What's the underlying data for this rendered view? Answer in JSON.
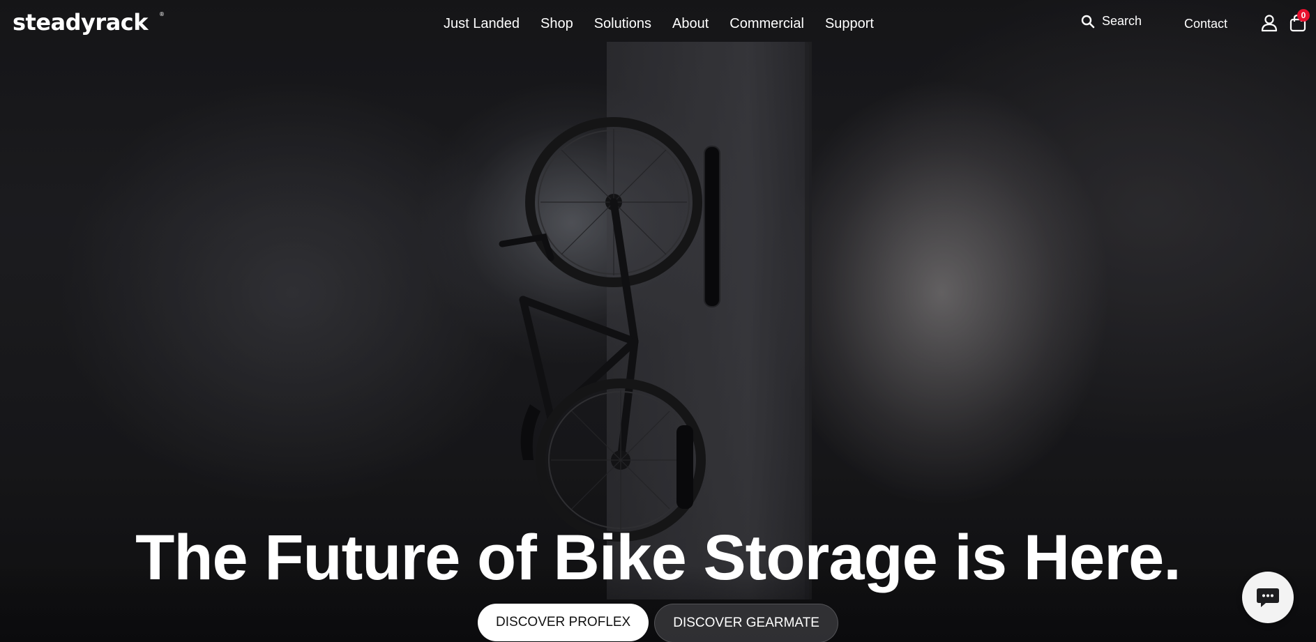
{
  "brand": {
    "logo_text": "steadyrack",
    "logo_mark": "®"
  },
  "nav": {
    "items": [
      {
        "label": "Just Landed"
      },
      {
        "label": "Shop"
      },
      {
        "label": "Solutions"
      },
      {
        "label": "About"
      },
      {
        "label": "Commercial"
      },
      {
        "label": "Support"
      }
    ]
  },
  "header": {
    "search_label": "Search",
    "contact_label": "Contact",
    "cart_count": "0",
    "icons": {
      "search": "search-icon",
      "account": "user-icon",
      "cart": "shopping-bag-icon"
    }
  },
  "hero": {
    "title": "The Future of Bike Storage is Here.",
    "primary_cta": "DISCOVER PROFLEX",
    "secondary_cta": "DISCOVER GEARMATE"
  },
  "chat": {
    "icon": "chat-bubble-icon"
  },
  "colors": {
    "badge": "#e8102e",
    "primary_button_bg": "#ffffff",
    "text": "#ffffff"
  }
}
